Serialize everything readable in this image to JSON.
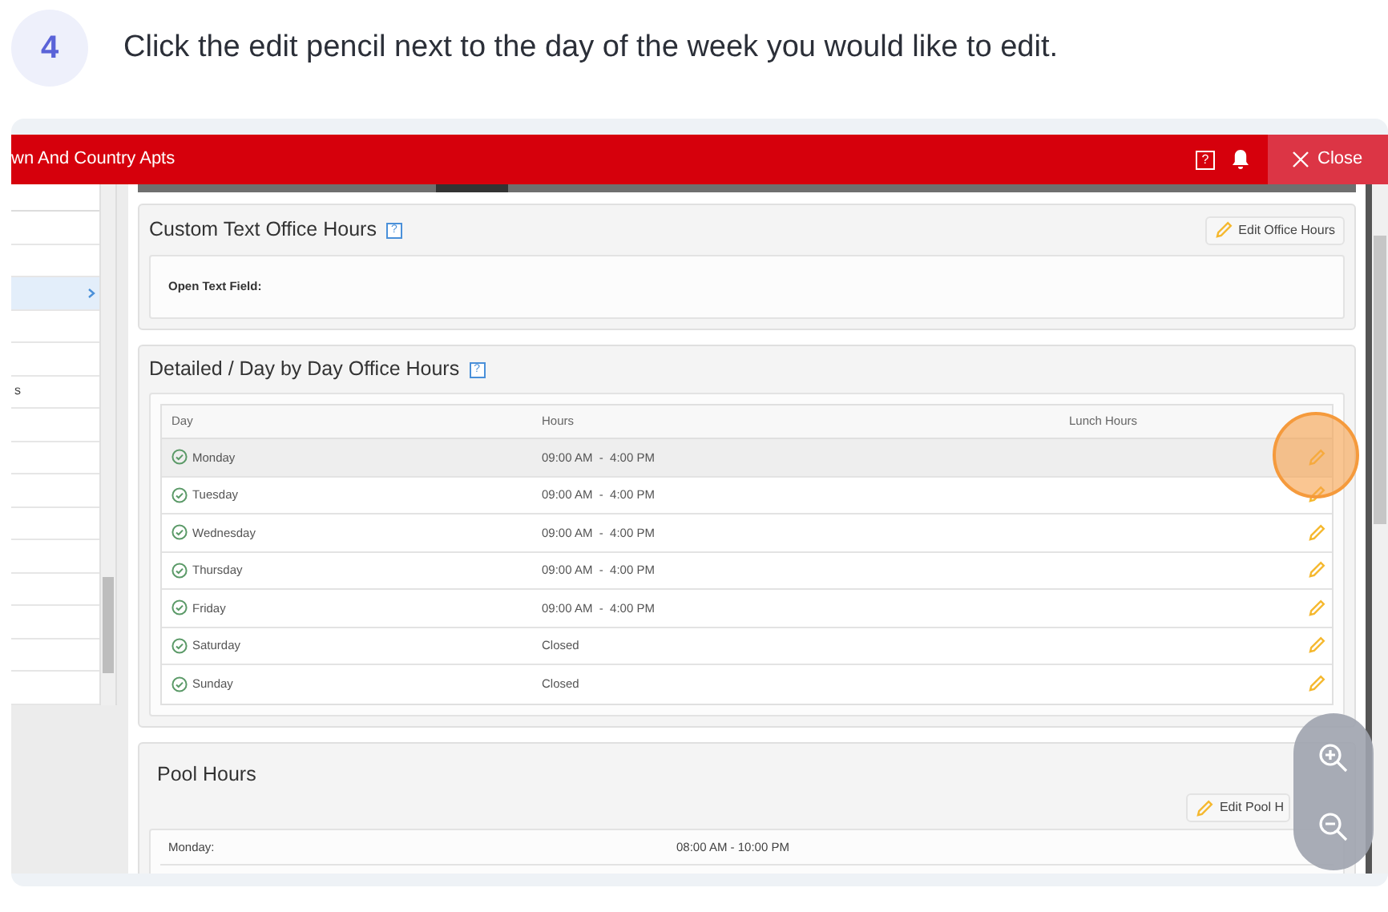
{
  "step": {
    "number": "4",
    "instruction": "Click the edit pencil next to the day of the week you would like to edit."
  },
  "app": {
    "title": "wn And Country Apts",
    "help_label": "?",
    "close_label": "Close"
  },
  "sidebar": {
    "items": [
      {
        "selected": false
      },
      {
        "selected": false
      },
      {
        "selected": true
      },
      {
        "selected": false
      },
      {
        "selected": false
      },
      {
        "label": "s",
        "selected": false
      },
      {
        "selected": false
      },
      {
        "selected": false
      },
      {
        "selected": false
      },
      {
        "selected": false
      },
      {
        "selected": false
      },
      {
        "selected": false
      },
      {
        "selected": false
      },
      {
        "selected": false
      },
      {
        "selected": false
      }
    ]
  },
  "custom_text_card": {
    "title": "Custom Text Office Hours",
    "help_label": "?",
    "edit_button": "Edit Office Hours",
    "field_label": "Open Text Field:"
  },
  "detailed_card": {
    "title": "Detailed / Day by Day Office Hours",
    "help_label": "?",
    "columns": [
      "Day",
      "Hours",
      "Lunch Hours"
    ],
    "rows": [
      {
        "day": "Monday",
        "hours": "09:00 AM  -  4:00 PM",
        "selected": true
      },
      {
        "day": "Tuesday",
        "hours": "09:00 AM  -  4:00 PM",
        "selected": false
      },
      {
        "day": "Wednesday",
        "hours": "09:00 AM  -  4:00 PM",
        "selected": false
      },
      {
        "day": "Thursday",
        "hours": "09:00 AM  -  4:00 PM",
        "selected": false
      },
      {
        "day": "Friday",
        "hours": "09:00 AM  -  4:00 PM",
        "selected": false
      },
      {
        "day": "Saturday",
        "hours": "Closed",
        "selected": false
      },
      {
        "day": "Sunday",
        "hours": "Closed",
        "selected": false
      }
    ]
  },
  "pool_card": {
    "title": "Pool Hours",
    "edit_button": "Edit Pool H",
    "rows": [
      {
        "day": "Monday:",
        "hours": "08:00 AM - 10:00 PM"
      }
    ]
  }
}
